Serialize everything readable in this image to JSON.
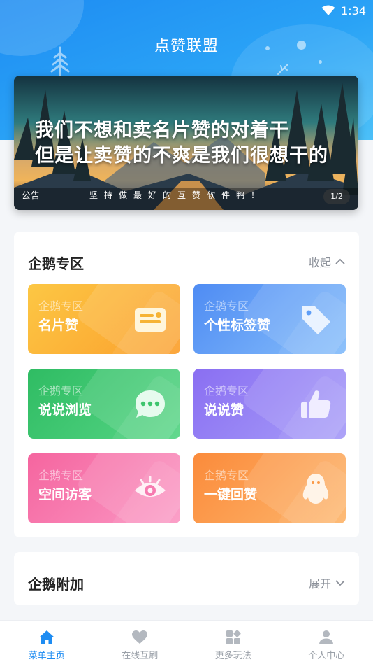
{
  "status_bar": {
    "time": "1:34"
  },
  "app_title": "点赞联盟",
  "banner": {
    "line1": "我们不想和卖名片赞的对着干",
    "line2": "但是让卖赞的不爽是我们很想干的",
    "notice_label": "公告",
    "notice_text": "坚持做最好的互赞软件鸭！",
    "pager": "1/2"
  },
  "section_qq": {
    "title": "企鹅专区",
    "toggle_label": "收起",
    "tiles": [
      {
        "sub": "企鹅专区",
        "label": "名片赞",
        "icon": "card-icon"
      },
      {
        "sub": "企鹅专区",
        "label": "个性标签赞",
        "icon": "tag-icon"
      },
      {
        "sub": "企鹅专区",
        "label": "说说浏览",
        "icon": "chat-icon"
      },
      {
        "sub": "企鹅专区",
        "label": "说说赞",
        "icon": "thumbs-up-icon"
      },
      {
        "sub": "企鹅专区",
        "label": "空间访客",
        "icon": "eye-icon"
      },
      {
        "sub": "企鹅专区",
        "label": "一键回赞",
        "icon": "penguin-icon"
      }
    ]
  },
  "section_extra": {
    "title": "企鹅附加",
    "toggle_label": "展开"
  },
  "bottom_nav": [
    {
      "label": "菜单主页",
      "icon": "home-icon",
      "active": true
    },
    {
      "label": "在线互刷",
      "icon": "heart-icon",
      "active": false
    },
    {
      "label": "更多玩法",
      "icon": "apps-icon",
      "active": false
    },
    {
      "label": "个人中心",
      "icon": "person-icon",
      "active": false
    }
  ],
  "colors": {
    "primary": "#1e8cf2",
    "tile_yellow": "#fbb232",
    "tile_blue": "#5f9ef7",
    "tile_green": "#3ec56e",
    "tile_purple": "#8d80f5",
    "tile_pink": "#f77ab0",
    "tile_orange": "#fb9a48"
  }
}
